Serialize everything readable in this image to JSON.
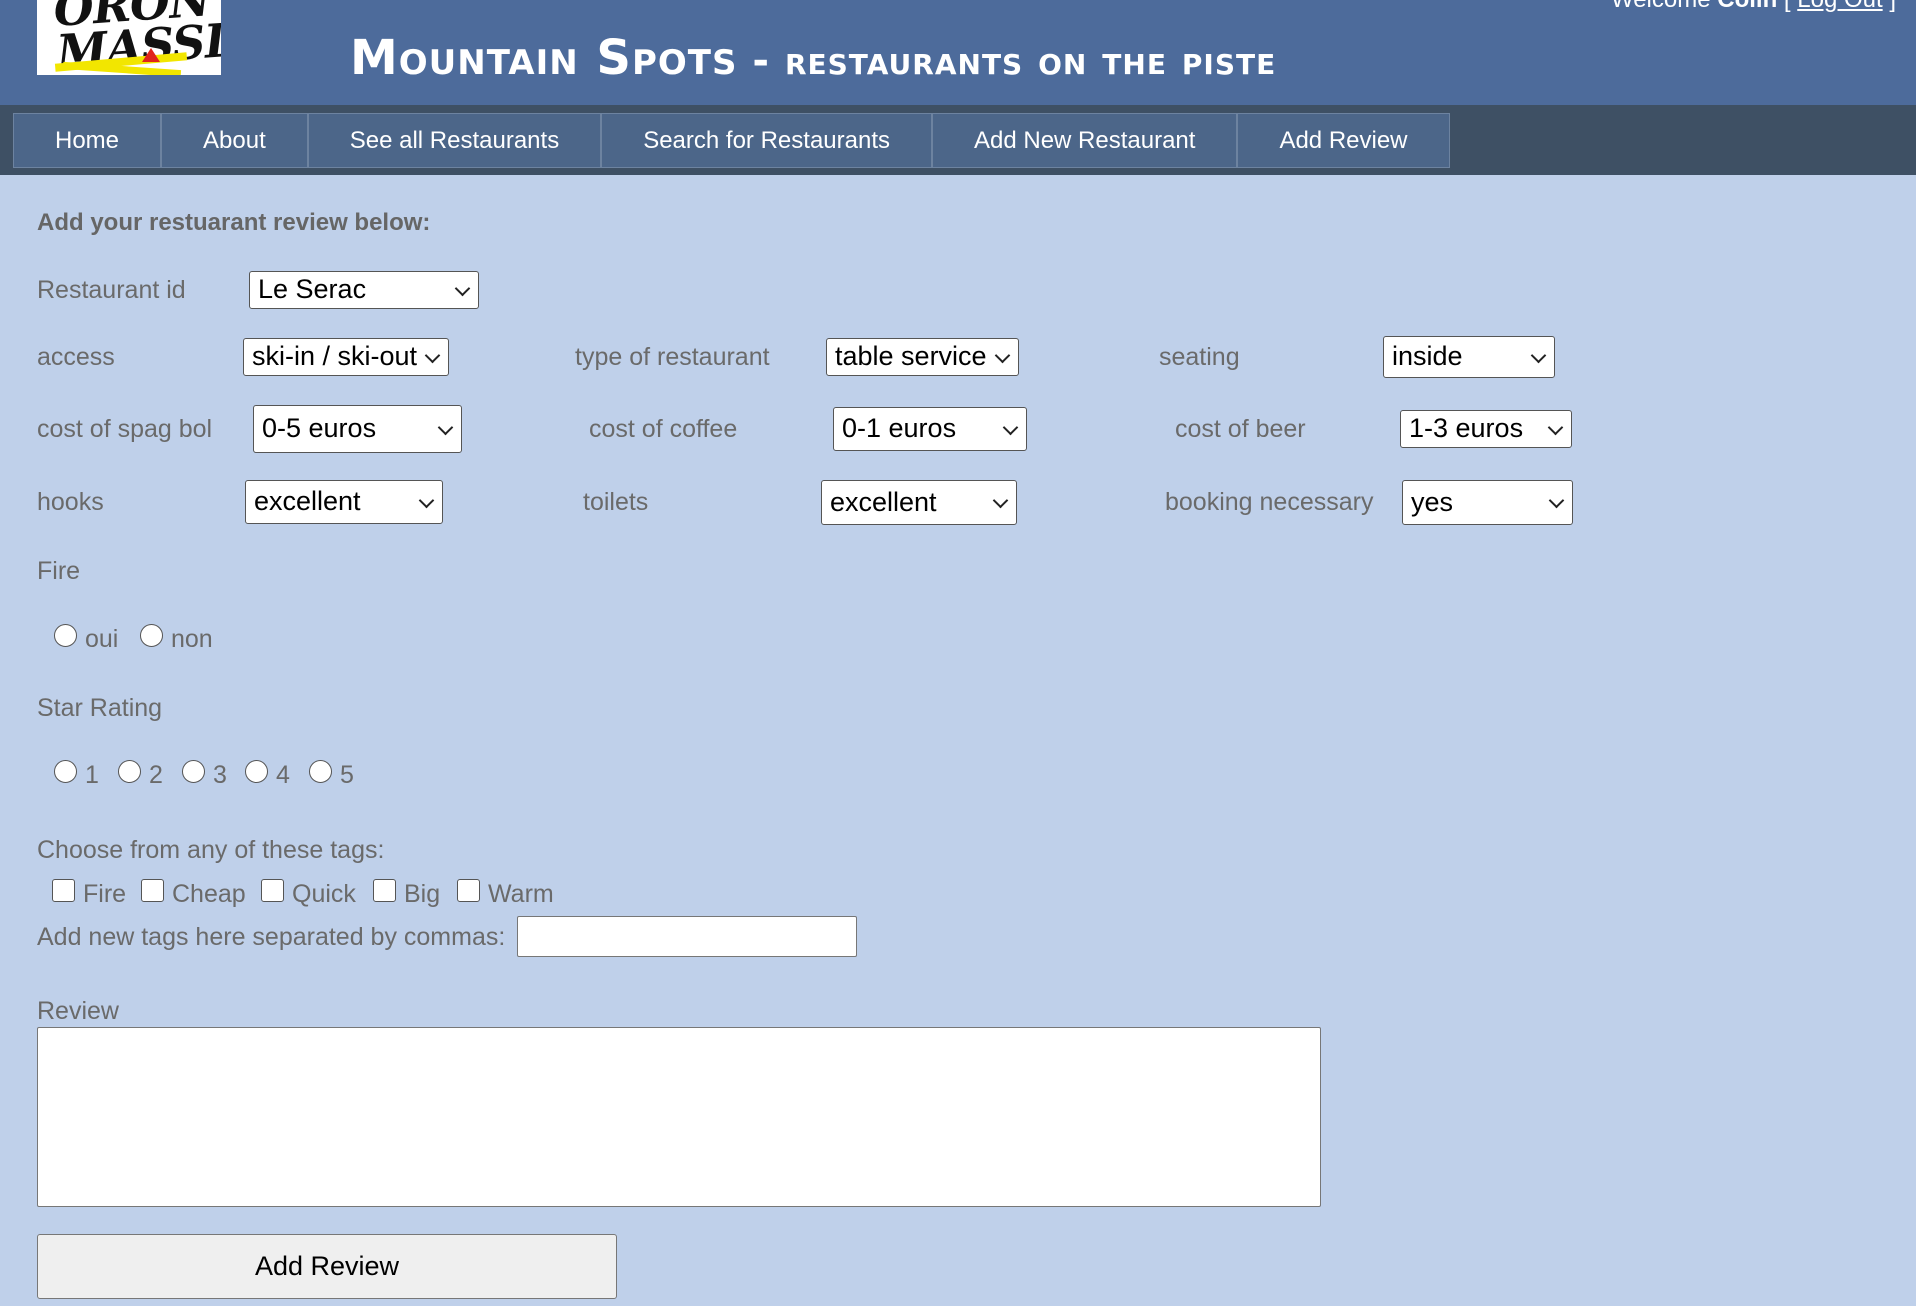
{
  "header": {
    "logo_text": "ORON MASSIF",
    "title": "Mountain Spots",
    "subtitle": " - restaurants on the piste",
    "welcome_prefix": "Welcome",
    "user_name": "Colin",
    "bracket_open": "[",
    "logout_label": "Log Out",
    "bracket_close": "]"
  },
  "nav": {
    "items": [
      "Home",
      "About",
      "See all Restaurants",
      "Search for Restaurants",
      "Add New Restaurant",
      "Add Review"
    ]
  },
  "form": {
    "heading": "Add your restuarant review below:",
    "restaurant_id": {
      "label": "Restaurant id",
      "value": "Le Serac"
    },
    "access": {
      "label": "access",
      "value": "ski-in / ski-out"
    },
    "type": {
      "label": "type of restaurant",
      "value": "table service"
    },
    "seating": {
      "label": "seating",
      "value": "inside"
    },
    "spag": {
      "label": "cost of spag bol",
      "value": "0-5 euros"
    },
    "coffee": {
      "label": "cost of coffee",
      "value": "0-1 euros"
    },
    "beer": {
      "label": "cost of beer",
      "value": "1-3 euros"
    },
    "hooks": {
      "label": "hooks",
      "value": "excellent"
    },
    "toilets": {
      "label": "toilets",
      "value": "excellent"
    },
    "booking": {
      "label": "booking necessary",
      "value": "yes"
    },
    "fire": {
      "label": "Fire",
      "options": [
        "oui",
        "non"
      ],
      "selected": null
    },
    "stars": {
      "label": "Star Rating",
      "options": [
        "1",
        "2",
        "3",
        "4",
        "5"
      ],
      "selected": null
    },
    "tags": {
      "label": "Choose from any of these tags:",
      "options": [
        "Fire",
        "Cheap",
        "Quick",
        "Big",
        "Warm"
      ],
      "checked": [],
      "new_tags_label": "Add new tags here separated by commas:",
      "new_tags_value": ""
    },
    "review": {
      "label": "Review",
      "value": ""
    },
    "submit_label": "Add Review"
  }
}
